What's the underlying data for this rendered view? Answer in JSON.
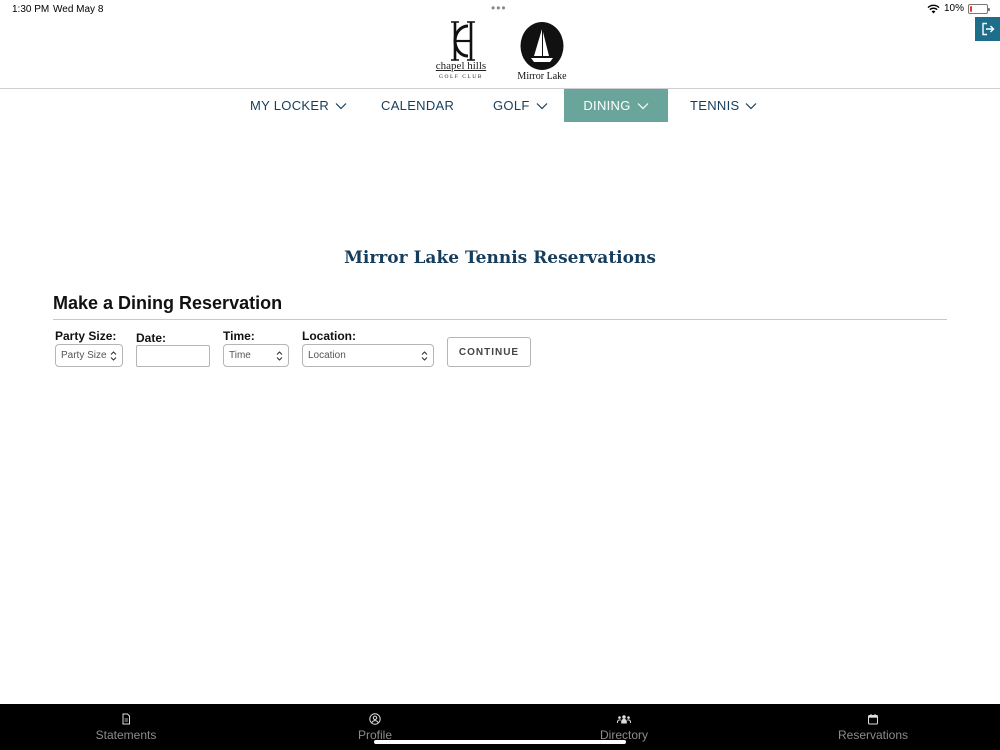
{
  "status_bar": {
    "time": "1:30 PM",
    "date": "Wed May 8",
    "battery": "10%",
    "battery_level": 0.1,
    "icons": [
      "more-dots-icon",
      "wifi-icon",
      "battery-icon"
    ]
  },
  "header": {
    "logo_chapel_hills": {
      "text": "chapel hills",
      "subtext": "GOLF CLUB"
    },
    "logo_mirror_lake": {
      "text": "Mirror Lake"
    },
    "logout_icon": "logout-icon"
  },
  "nav": {
    "items": [
      {
        "label": "MY LOCKER",
        "has_dropdown": true
      },
      {
        "label": "CALENDAR",
        "has_dropdown": false
      },
      {
        "label": "GOLF",
        "has_dropdown": true
      },
      {
        "label": "DINING",
        "has_dropdown": true,
        "active": true
      },
      {
        "label": "TENNIS",
        "has_dropdown": true
      }
    ]
  },
  "main": {
    "title": "Mirror Lake Tennis Reservations",
    "heading": "Make a Dining Reservation",
    "form": {
      "party_size": {
        "label": "Party Size:",
        "value": "Party Size"
      },
      "date": {
        "label": "Date:",
        "value": ""
      },
      "time": {
        "label": "Time:",
        "value": "Time"
      },
      "location": {
        "label": "Location:",
        "value": "Location"
      },
      "continue_label": "CONTINUE"
    }
  },
  "tab_bar": {
    "tabs": [
      {
        "label": "Statements",
        "icon": "document-icon"
      },
      {
        "label": "Profile",
        "icon": "user-circle-icon"
      },
      {
        "label": "Directory",
        "icon": "people-icon"
      },
      {
        "label": "Reservations",
        "icon": "calendar-icon"
      }
    ]
  },
  "colors": {
    "nav_text": "#163e5c",
    "nav_active_bg": "#6aa59b",
    "title": "#163e5c",
    "logout_bg": "#1d6e8a",
    "tab_bar_bg": "#000000",
    "battery_low": "#e53935"
  }
}
